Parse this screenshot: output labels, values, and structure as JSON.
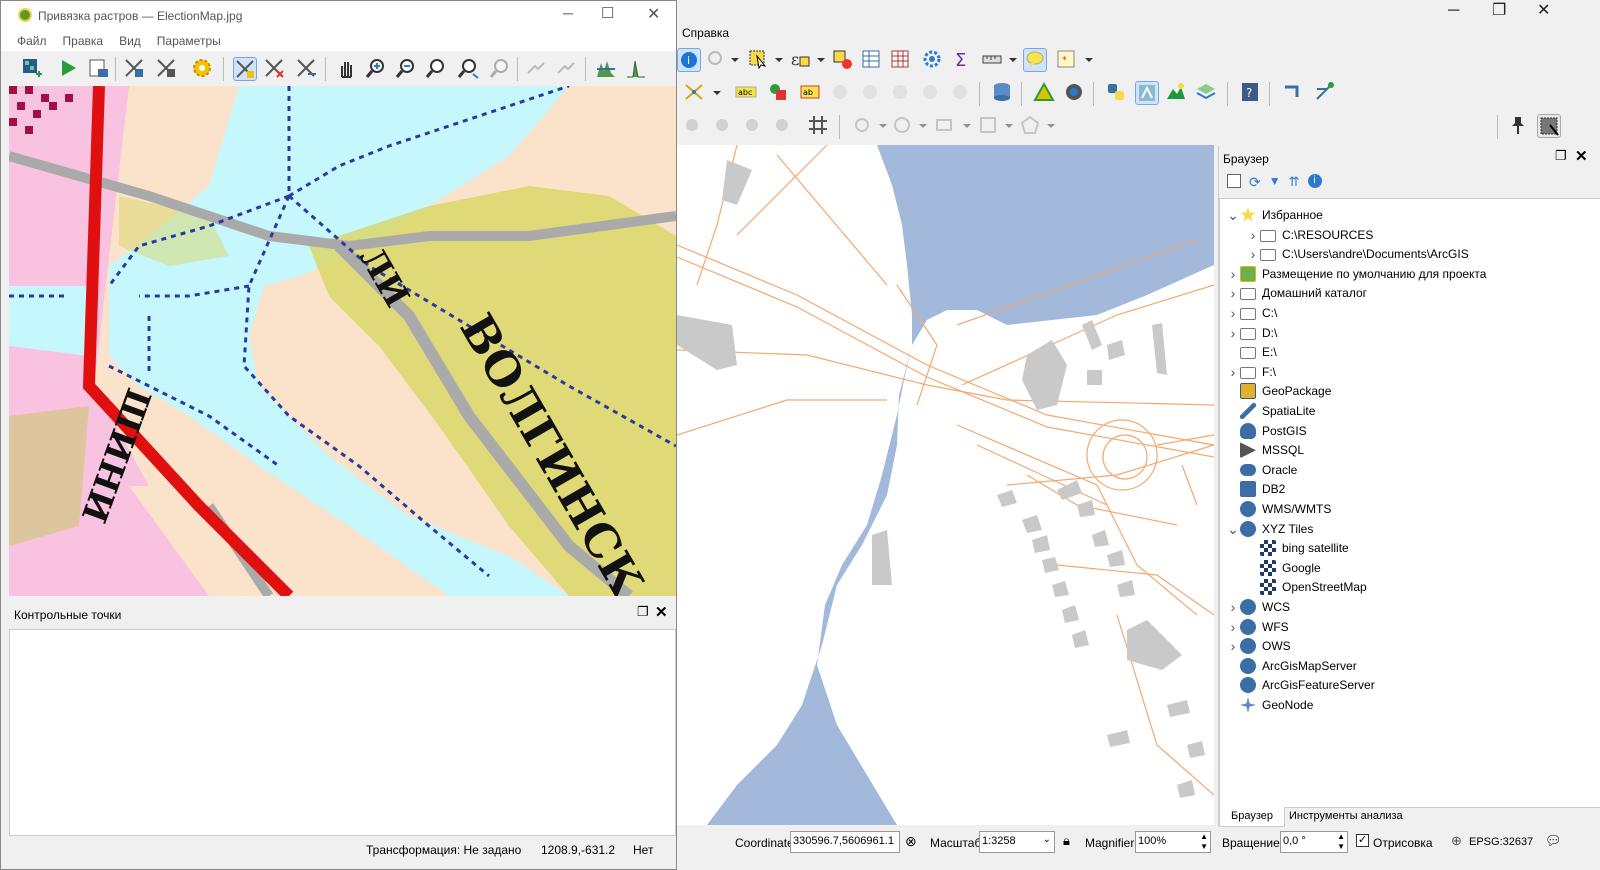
{
  "main_window": {
    "menu_visible": "Справка",
    "window_controls": [
      "minimize-icon",
      "restore-icon",
      "close-icon"
    ]
  },
  "browser_panel": {
    "title": "Браузер",
    "items": [
      {
        "label": "Избранное",
        "icon": "star-icon",
        "expanded": true,
        "level": 0
      },
      {
        "label": "C:\\RESOURCES",
        "icon": "folder-icon",
        "level": 1
      },
      {
        "label": "C:\\Users\\andre\\Documents\\ArcGIS",
        "icon": "folder-icon",
        "level": 1
      },
      {
        "label": "Размещение по умолчанию для проекта",
        "icon": "project-home-icon",
        "level": 0
      },
      {
        "label": "Домашний каталог",
        "icon": "home-folder-icon",
        "level": 0
      },
      {
        "label": "C:\\",
        "icon": "folder-icon",
        "level": 0
      },
      {
        "label": "D:\\",
        "icon": "folder-icon",
        "level": 0
      },
      {
        "label": "E:\\",
        "icon": "folder-icon",
        "level": 0
      },
      {
        "label": "F:\\",
        "icon": "folder-icon",
        "level": 0
      },
      {
        "label": "GeoPackage",
        "icon": "geopackage-icon",
        "level": 0
      },
      {
        "label": "SpatiaLite",
        "icon": "spatialite-icon",
        "level": 0
      },
      {
        "label": "PostGIS",
        "icon": "postgis-icon",
        "level": 0
      },
      {
        "label": "MSSQL",
        "icon": "mssql-icon",
        "level": 0
      },
      {
        "label": "Oracle",
        "icon": "oracle-icon",
        "level": 0
      },
      {
        "label": "DB2",
        "icon": "db2-icon",
        "level": 0
      },
      {
        "label": "WMS/WMTS",
        "icon": "globe-icon",
        "level": 0
      },
      {
        "label": "XYZ Tiles",
        "icon": "globe-icon",
        "expanded": true,
        "level": 0
      },
      {
        "label": "bing satellite",
        "icon": "tiles-icon",
        "level": 1
      },
      {
        "label": "Google",
        "icon": "tiles-icon",
        "level": 1
      },
      {
        "label": "OpenStreetMap",
        "icon": "tiles-icon",
        "level": 1
      },
      {
        "label": "WCS",
        "icon": "globe-icon",
        "level": 0
      },
      {
        "label": "WFS",
        "icon": "globe-icon",
        "level": 0
      },
      {
        "label": "OWS",
        "icon": "globe-icon",
        "level": 0
      },
      {
        "label": "ArcGisMapServer",
        "icon": "globe-icon",
        "level": 0
      },
      {
        "label": "ArcGisFeatureServer",
        "icon": "globe-icon",
        "level": 0
      },
      {
        "label": "GeoNode",
        "icon": "geonode-icon",
        "level": 0
      }
    ],
    "tabs": [
      "Браузер",
      "Инструменты анализа"
    ]
  },
  "status_bar": {
    "coordinate_label": "Coordinate",
    "coordinate_value": "330596.7,5606961.1",
    "scale_label": "Масштаб",
    "scale_value": "1:3258",
    "magnifier_label": "Magnifier",
    "magnifier_value": "100%",
    "rotation_label": "Вращение",
    "rotation_value": "0,0 °",
    "render_label": "Отрисовка",
    "crs": "EPSG:32637"
  },
  "georef_window": {
    "title": "Привязка растров — ElectionMap.jpg",
    "menu": [
      "Файл",
      "Правка",
      "Вид",
      "Параметры"
    ],
    "gcp_panel_title": "Контрольные точки",
    "status_transform": "Трансформация: Не задано",
    "status_coords": "1208.9,-631.2",
    "status_none": "Нет"
  }
}
